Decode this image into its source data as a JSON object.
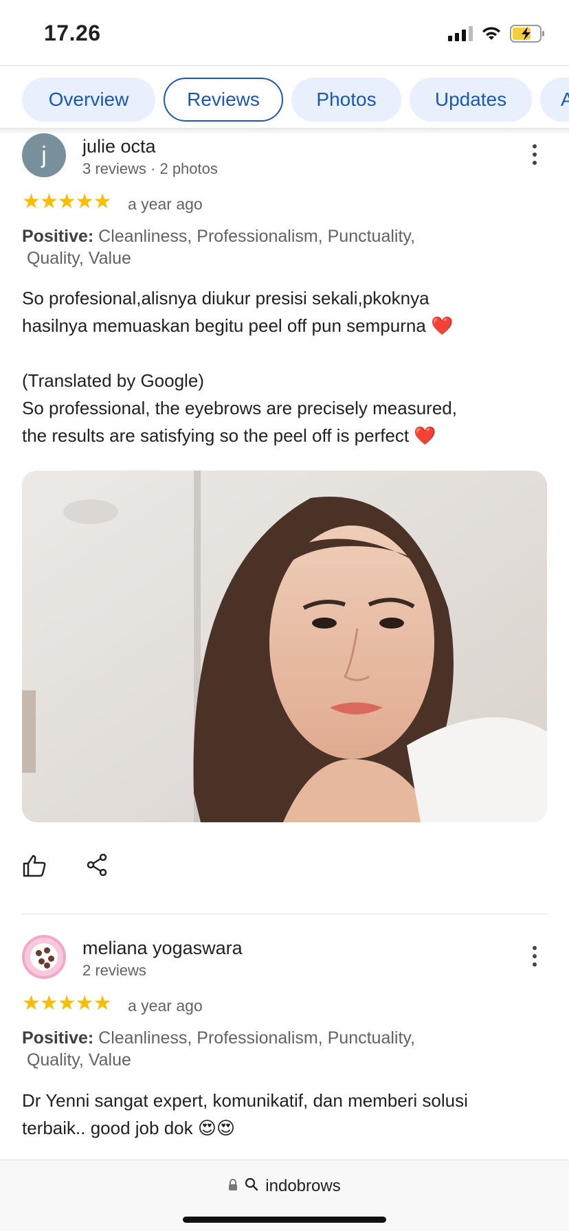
{
  "status_bar": {
    "time": "17.26",
    "icons": [
      "cellular-signal-icon",
      "wifi-icon",
      "battery-charging-icon"
    ]
  },
  "tabs": [
    {
      "label": "Overview",
      "active": false
    },
    {
      "label": "Reviews",
      "active": true
    },
    {
      "label": "Photos",
      "active": false
    },
    {
      "label": "Updates",
      "active": false
    },
    {
      "label": "A",
      "active": false
    }
  ],
  "reviews": [
    {
      "avatar_letter": "j",
      "name": "julie octa",
      "meta": "3 reviews · 2 photos",
      "stars": "★★★★★",
      "rating": 5,
      "time": "a year ago",
      "positive_label": "Positive:",
      "positive_items": "Cleanliness, Professionalism, Punctuality,",
      "positive_items_2": "Quality, Value",
      "original_line_1": "So profesional,alisnya diukur presisi sekali,pkoknya",
      "original_line_2": "hasilnya memuaskan begitu peel off pun sempurna",
      "translated_note": "(Translated by Google)",
      "translated_line_1": "So professional, the eyebrows are precisely measured,",
      "translated_line_2": "the results are satisfying so the peel off is perfect",
      "emoji": "❤️",
      "photo": "review-photo"
    },
    {
      "name": "meliana yogaswara",
      "meta": "2 reviews",
      "stars": "★★★★★",
      "rating": 5,
      "time": "a year ago",
      "positive_label": "Positive:",
      "positive_items": "Cleanliness, Professionalism, Punctuality,",
      "positive_items_2": "Quality, Value",
      "text_line_1": "Dr Yenni sangat expert, komunikatif, dan memberi solusi",
      "text_line_2": "terbaik.. good job dok",
      "emoji": "😍😍"
    }
  ],
  "browser": {
    "url_text": "indobrows",
    "icons": [
      "lock-icon",
      "search-icon"
    ]
  },
  "colors": {
    "accent_blue": "#1a56b8",
    "tab_bg": "#e8f0fe",
    "star": "#fbbc04",
    "heart": "#e53935"
  }
}
